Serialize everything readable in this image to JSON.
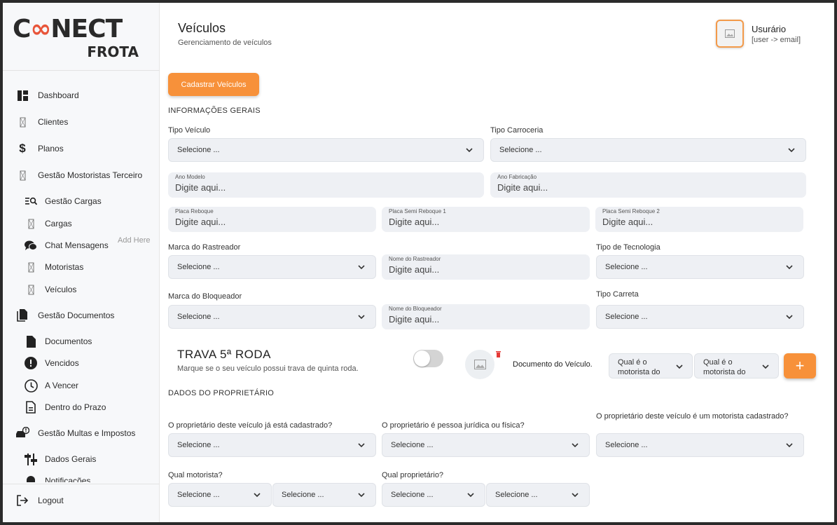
{
  "brand": {
    "logo_line1_a": "C",
    "logo_line1_b": "NECT",
    "logo_line2": "FROTA"
  },
  "sidebar": {
    "items": [
      {
        "label": "Dashboard",
        "icon": "dashboard-icon"
      },
      {
        "label": "Clientes",
        "icon": "missing-glyph-icon"
      },
      {
        "label": "Planos",
        "icon": "dollar-icon"
      },
      {
        "label": "Gestão Mostoristas Terceiro",
        "icon": "missing-glyph-icon"
      },
      {
        "label": "Gestão Cargas",
        "icon": "list-search-icon"
      },
      {
        "label": "Cargas",
        "icon": "missing-glyph-icon"
      },
      {
        "label": "Chat Mensagens",
        "icon": "chat-icon"
      },
      {
        "label": "Motoristas",
        "icon": "missing-glyph-icon"
      },
      {
        "label": "Veículos",
        "icon": "missing-glyph-icon"
      },
      {
        "label": "Gestão Documentos",
        "icon": "documents-icon"
      },
      {
        "label": "Documentos",
        "icon": "document-icon"
      },
      {
        "label": "Vencidos",
        "icon": "alert-circle-icon"
      },
      {
        "label": "A Vencer",
        "icon": "clock-icon"
      },
      {
        "label": "Dentro do Prazo",
        "icon": "document-lines-icon"
      },
      {
        "label": "Gestão Multas e Impostos",
        "icon": "car-alert-icon"
      },
      {
        "label": "Dados Gerais",
        "icon": "signpost-icon"
      },
      {
        "label": "Notificações",
        "icon": "bell-icon"
      }
    ],
    "add_here": "Add Here",
    "logout": "Logout"
  },
  "header": {
    "title": "Veículos",
    "subtitle": "Gerenciamento de veículos",
    "user_name": "Usurário",
    "user_email": "[user -> email]"
  },
  "main": {
    "register_button": "Cadastrar Veículos",
    "section_general": "INFORMAÇÕES GERAIS",
    "section_owner": "DADOS DO PROPRIETÁRIO",
    "select_placeholder": "Selecione ...",
    "input_placeholder": "Digite aqui...",
    "labels": {
      "tipo_veiculo": "Tipo Veículo",
      "tipo_carroceria": "Tipo Carroceria",
      "ano_modelo": "Ano Modelo",
      "ano_fabricacao": "Ano Fabricação",
      "placa_reboque": "Placa Reboque",
      "placa_semi_1": "Placa Semi Reboque 1",
      "placa_semi_2": "Placa Semi Reboque 2",
      "marca_rastreador": "Marca do Rastreador",
      "nome_rastreador": "Nome do Rastreador",
      "tipo_tecnologia": "Tipo de Tecnologia",
      "marca_bloqueador": "Marca do Bloqueador",
      "nome_bloqueador": "Nome do Bloqueador",
      "tipo_carreta": "Tipo Carreta",
      "owner_registered": "O proprietário deste veículo já está cadastrado?",
      "owner_type": "O proprietário é pessoa jurídica ou física?",
      "owner_driver": "O proprietário deste veículo é um motorista cadastrado?",
      "qual_motorista": "Qual motorista?",
      "qual_proprietario": "Qual proprietário?"
    },
    "trava": {
      "title": "TRAVA 5ª RODA",
      "subtitle": "Marque se o seu veículo possui trava de quinta roda.",
      "enabled": false
    },
    "document_label": "Documento do Veículo.",
    "motorista_select_line1": "Qual é o",
    "motorista_select_line2": "motorista do",
    "plus_label": "+"
  },
  "colors": {
    "accent": "#f7913a",
    "logo_red": "#e8553a"
  }
}
